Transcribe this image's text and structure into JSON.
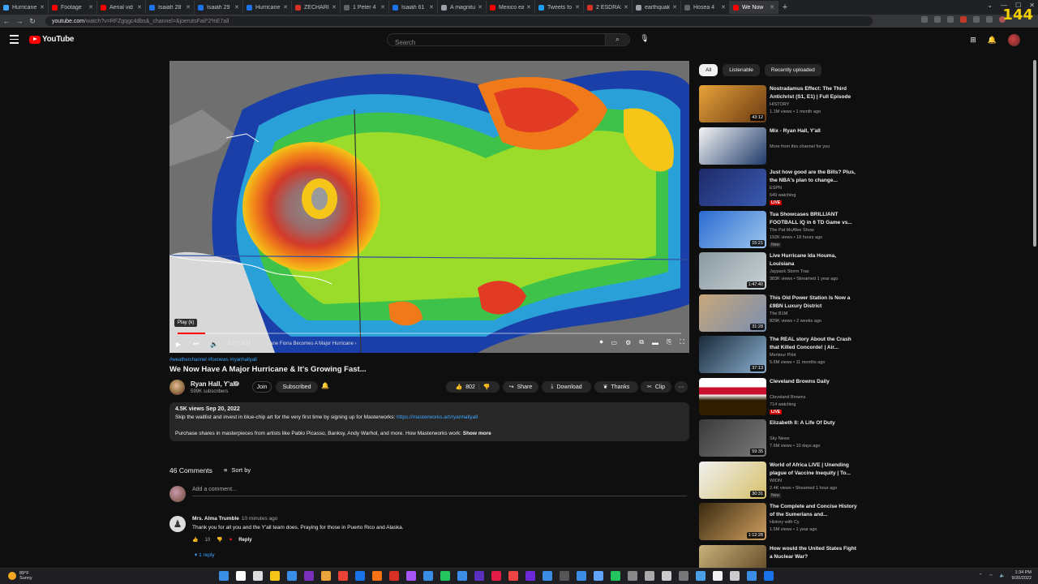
{
  "browser": {
    "tabs": [
      {
        "label": "Hurricane",
        "color": "#3ea6ff"
      },
      {
        "label": "Footage",
        "color": "#ff0000"
      },
      {
        "label": "Aerial vid",
        "color": "#ff0000"
      },
      {
        "label": "Isaiah 28",
        "color": "#1a73e8"
      },
      {
        "label": "Isaiah 29",
        "color": "#1a73e8"
      },
      {
        "label": "Hurricane",
        "color": "#1a73e8"
      },
      {
        "label": "ZECHARI",
        "color": "#d93025"
      },
      {
        "label": "1 Peter 4",
        "color": "#5f6368"
      },
      {
        "label": "Isaiah 61",
        "color": "#1a73e8"
      },
      {
        "label": "A magnitu",
        "color": "#9aa0a6"
      },
      {
        "label": "Mexico ea",
        "color": "#ff0000"
      },
      {
        "label": "Tweets fo",
        "color": "#1d9bf0"
      },
      {
        "label": "2 ESDRAS",
        "color": "#d93025"
      },
      {
        "label": "earthquak",
        "color": "#9aa0a6"
      },
      {
        "label": "Hosea 4",
        "color": "#5f6368"
      },
      {
        "label": "We Now",
        "color": "#ff0000"
      }
    ],
    "url_host": "youtube.com",
    "url_path": "/watch?v=RFZgqgc4dbs&_channel=&joerutsFail*2%E7all",
    "fps": "144"
  },
  "youtube": {
    "logo_text": "YouTube",
    "search_placeholder": "Search"
  },
  "player": {
    "tooltip": "Play (k)",
    "time": "0:27 / 8:17",
    "chapter": "• Hurricane Fiona Becomes A Major Hurricane  ›",
    "progress": 0.054
  },
  "video": {
    "hashtags": "#weatherchannel #foxnews #ryanhallyall",
    "title": "We Now Have A Major Hurricane & It's Growing Fast...",
    "channel": "Ryan Hall, Y'all",
    "subscribers": "599K subscribers",
    "join": "Join",
    "subscribed": "Subscribed",
    "likes": "802",
    "share": "Share",
    "download": "Download",
    "thanks": "Thanks",
    "clip": "Clip",
    "more": "···",
    "views_date": "4.5K views  Sep 20, 2022",
    "desc_line1": "Skip the waitlist and invest in blue-chip art for the very first time by signing up for Masterworks: ",
    "desc_link": "https://masterworks.art/ryanhallyall",
    "desc_line2": "Purchase shares in masterpieces from artists like Pablo Picasso, Banksy, Andy Warhol, and more. How Masterworks work: ",
    "show_more": "Show more"
  },
  "comments": {
    "count": "46 Comments",
    "sort": "Sort by",
    "add_placeholder": "Add a comment...",
    "first": {
      "author": "Mrs. Alma Trumble",
      "time": "10 minutes ago",
      "text": "Thank you for all you and the Y'all team does. Praying for those in Puerto Rico and Alaska.",
      "likes": "10",
      "reply": "Reply"
    },
    "replies": "1 reply"
  },
  "sidebar": {
    "chips": [
      "All",
      "Listenable",
      "Recently uploaded"
    ],
    "items": [
      {
        "title": "Nostradamus Effect: The Third Antichrist (S1, E1) | Full Episode",
        "channel": "HISTORY",
        "meta": "1.1M views • 1 month ago",
        "duration": "43:12",
        "badge": "",
        "live": ""
      },
      {
        "title": "Mix - Ryan Hall, Y'all",
        "channel": "More from this channel for you",
        "meta": "",
        "duration": "",
        "badge": "",
        "live": ""
      },
      {
        "title": "Just how good are the Bills? Plus, the NBA's plan to change...",
        "channel": "ESPN",
        "meta": "649 watching",
        "duration": "",
        "badge": "",
        "live": "LIVE"
      },
      {
        "title": "Tua Showcases BRILLIANT FOOTBALL IQ in 6 TD Game vs...",
        "channel": "The Pat McAfee Show",
        "meta": "192K views • 18 hours ago",
        "duration": "15:21",
        "badge": "New",
        "live": ""
      },
      {
        "title": "Live Hurricane Ida Houma, Louisiana",
        "channel": "Jaypack Storm Trax",
        "meta": "383K views • Streamed 1 year ago",
        "duration": "1:47:40",
        "badge": "",
        "live": ""
      },
      {
        "title": "This Old Power Station Is Now a £9BN Luxury District",
        "channel": "The B1M",
        "meta": "829K views • 2 weeks ago",
        "duration": "31:28",
        "badge": "",
        "live": ""
      },
      {
        "title": "The REAL story About the Crash that Killed Concorde! | Air...",
        "channel": "Mentour Pilot",
        "meta": "5.6M views • 11 months ago",
        "duration": "37:13",
        "badge": "",
        "live": ""
      },
      {
        "title": "Cleveland Browns Daily",
        "channel": "Cleveland Browns",
        "meta": "714 watching",
        "duration": "",
        "badge": "",
        "live": "LIVE"
      },
      {
        "title": "Elizabeth II: A Life Of Duty",
        "channel": "Sky News",
        "meta": "7.6M views • 10 days ago",
        "duration": "59:35",
        "badge": "",
        "live": ""
      },
      {
        "title": "World of Africa LIVE | Unending plague of Vaccine Inequity | To...",
        "channel": "WION",
        "meta": "2.4K views • Streamed 1 hour ago",
        "duration": "30:31",
        "badge": "New",
        "live": ""
      },
      {
        "title": "The Complete and Concise History of the Sumerians and...",
        "channel": "History with Cy",
        "meta": "1.5M views • 1 year ago",
        "duration": "1:12:28",
        "badge": "",
        "live": ""
      },
      {
        "title": "How would the United States Fight a Nuclear War?",
        "channel": "",
        "meta": "",
        "duration": "",
        "badge": "",
        "live": ""
      }
    ]
  },
  "taskbar": {
    "temp": "89°F",
    "condition": "Sunny",
    "time": "1:34 PM",
    "date": "9/20/2022"
  }
}
